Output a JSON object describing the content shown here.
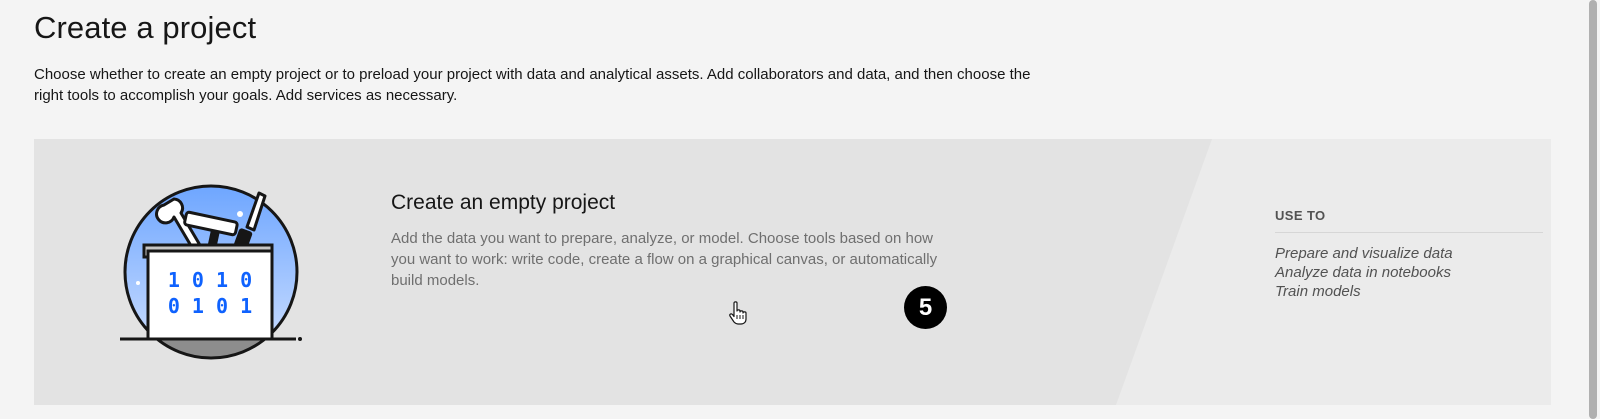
{
  "header": {
    "title": "Create a project",
    "description": "Choose whether to create an empty project or to preload your project with data and analytical assets. Add collaborators and data, and then choose the right tools to accomplish your goals. Add services as necessary."
  },
  "card": {
    "title": "Create an empty project",
    "description": "Add the data you want to prepare, analyze, or model. Choose tools based on how you want to work: write code, create a flow on a graphical canvas, or automatically build models.",
    "illustration": {
      "binary_row1": "1 0 1 0",
      "binary_row2": "0 1 0 1"
    },
    "use_to": {
      "heading": "USE TO",
      "items": [
        "Prepare and visualize data",
        "Analyze data in notebooks",
        "Train models"
      ]
    }
  },
  "step_badge": "5",
  "colors": {
    "background": "#f4f4f4",
    "card": "#e8e8e8",
    "card_right": "#ececec",
    "binary_blue": "#0f62fe"
  }
}
